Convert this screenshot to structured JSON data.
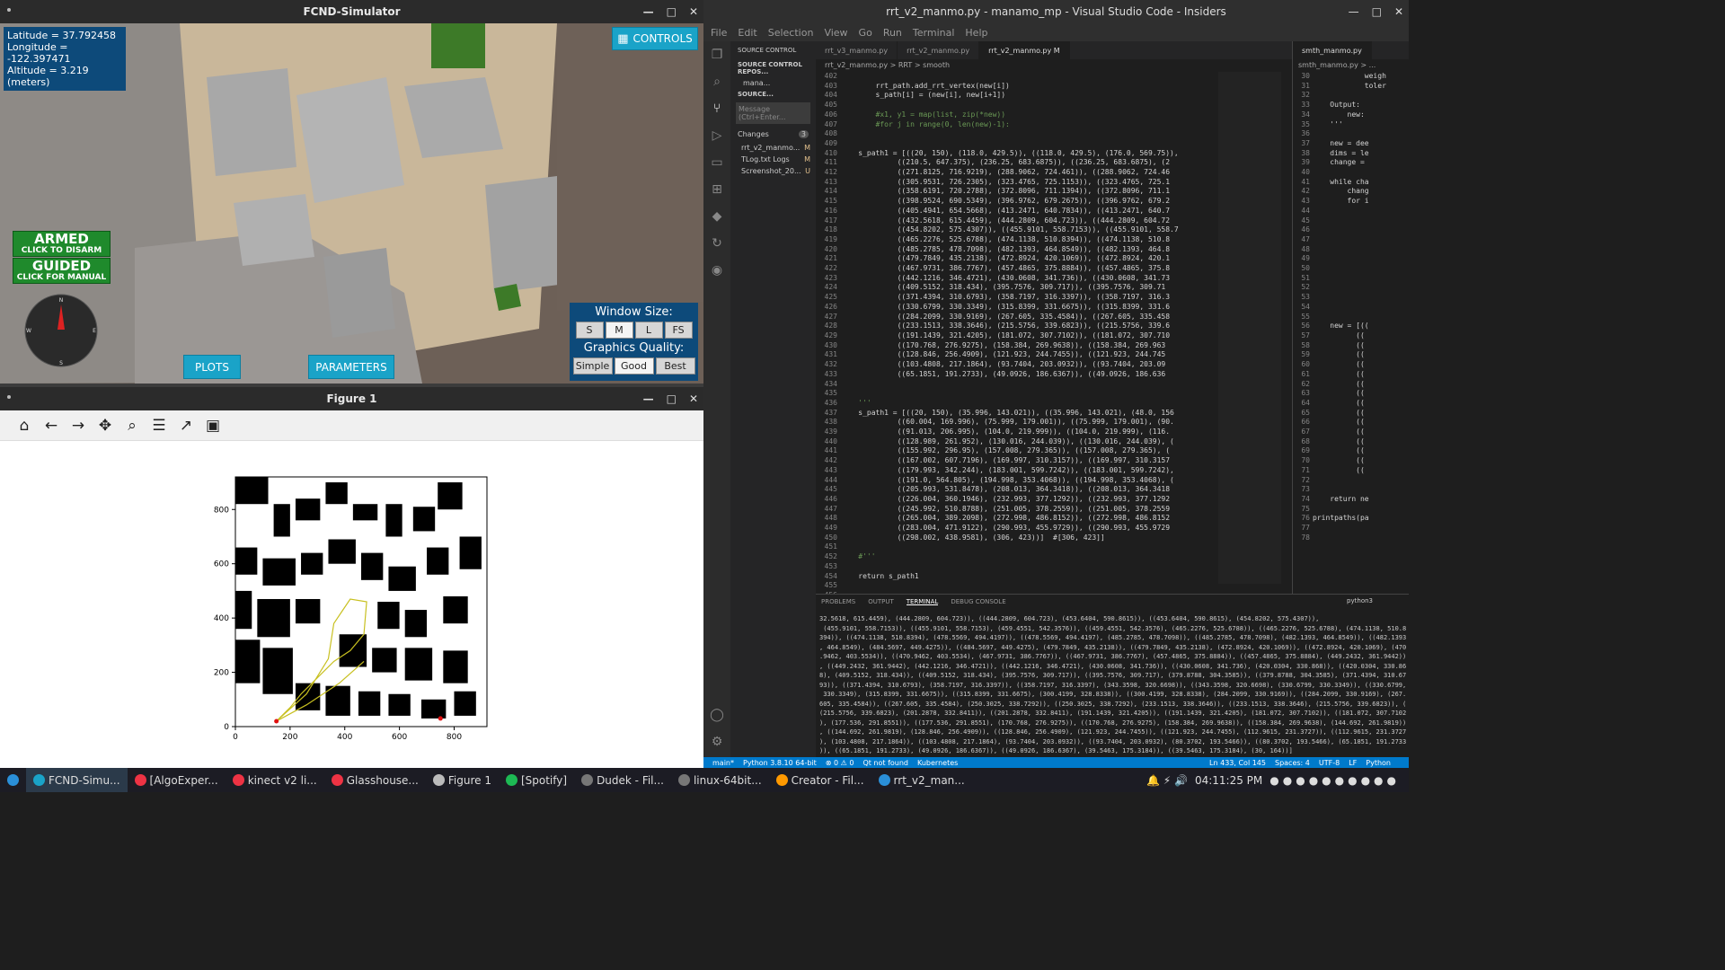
{
  "simulator": {
    "title": "FCND-Simulator",
    "latitude": "Latitude = 37.792458",
    "longitude": "Longitude = -122.397471",
    "altitude": "Altitude = 3.219 (meters)",
    "controls_label": "CONTROLS",
    "armed_label": "ARMED",
    "armed_sub": "CLICK TO DISARM",
    "guided_label": "GUIDED",
    "guided_sub": "CLICK FOR MANUAL",
    "plots_label": "PLOTS",
    "parameters_label": "PARAMETERS",
    "window_size_label": "Window Size:",
    "size_options": [
      "S",
      "M",
      "L",
      "FS"
    ],
    "graphics_label": "Graphics Quality:",
    "quality_options": [
      "Simple",
      "Good",
      "Best"
    ],
    "compass": {
      "n": "N",
      "e": "E",
      "s": "S",
      "w": "W"
    }
  },
  "figure": {
    "title": "Figure 1",
    "chart_data": {
      "type": "line",
      "xticks": [
        "0",
        "200",
        "400",
        "600",
        "800"
      ],
      "yticks": [
        "0",
        "200",
        "400",
        "600",
        "800"
      ],
      "xlim": [
        0,
        920
      ],
      "ylim": [
        0,
        920
      ],
      "path_color": "#c8c020",
      "points_color": "#e01010",
      "start": [
        150,
        20
      ],
      "goal": [
        750,
        30
      ],
      "series": [
        {
          "x": [
            150,
            260,
            340,
            360,
            420,
            480,
            470,
            420,
            360,
            300,
            240,
            200,
            160,
            150
          ],
          "y": [
            20,
            120,
            250,
            380,
            470,
            460,
            340,
            280,
            240,
            180,
            120,
            70,
            30,
            20
          ]
        },
        {
          "x": [
            150,
            260,
            380,
            470
          ],
          "y": [
            20,
            80,
            160,
            240
          ]
        }
      ]
    }
  },
  "vscode": {
    "title": "rrt_v2_manmo.py - manamo_mp - Visual Studio Code - Insiders",
    "menu": [
      "File",
      "Edit",
      "Selection",
      "View",
      "Go",
      "Run",
      "Terminal",
      "Help"
    ],
    "side_title": "SOURCE CONTROL",
    "side_repo": "SOURCE CONTROL REPOS...",
    "side_repo_item": "mana...",
    "side_source": "SOURCE...",
    "message_placeholder": "Message (Ctrl+Enter...",
    "changes_label": "Changes",
    "changes_count": "3",
    "changed_files": [
      {
        "name": "rrt_v2_manmo...",
        "status": "M"
      },
      {
        "name": "TLog.txt Logs",
        "status": "M"
      },
      {
        "name": "Screenshot_20...",
        "status": "U"
      }
    ],
    "tabs": [
      "rrt_v3_manmo.py",
      "rrt_v2_manmo.py",
      "rrt_v2_manmo.py M"
    ],
    "right_tab": "smth_manmo.py",
    "breadcrumb": "rrt_v2_manmo.py > RRT > smooth",
    "right_breadcrumb": "smth_manmo.py > ...",
    "code_start_line": 402,
    "code": [
      "",
      "        rrt_path.add_rrt_vertex(new[i])",
      "        s_path[i] = (new[i], new[i+1])",
      "",
      "        #x1, y1 = map(list, zip(*new))",
      "        #for j in range(0, len(new)-1):",
      "",
      "",
      "    s_path1 = [((20, 150), (118.0, 429.5)), ((118.0, 429.5), (176.0, 569.75)),",
      "             ((210.5, 647.375), (236.25, 683.6875)), ((236.25, 683.6875), (2",
      "             ((271.8125, 716.9219), (288.9062, 724.461)), ((288.9062, 724.46",
      "             ((305.9531, 726.2305), (323.4765, 725.1153)), ((323.4765, 725.1",
      "             ((358.6191, 720.2788), (372.8096, 711.1394)), ((372.8096, 711.1",
      "             ((398.9524, 690.5349), (396.9762, 679.2675)), ((396.9762, 679.2",
      "             ((405.4941, 654.5668), (413.2471, 640.7834)), ((413.2471, 640.7",
      "             ((432.5618, 615.4459), (444.2809, 604.723)), ((444.2809, 604.72",
      "             ((454.8202, 575.4307)), ((455.9101, 558.7153)), ((455.9101, 558.7",
      "             ((465.2276, 525.6788), (474.1138, 510.8394)), ((474.1138, 510.8",
      "             ((485.2785, 478.7098), (482.1393, 464.8549)), ((482.1393, 464.8",
      "             ((479.7849, 435.2138), (472.8924, 420.1069)), ((472.8924, 420.1",
      "             ((467.9731, 386.7767), (457.4865, 375.8884)), ((457.4865, 375.8",
      "             ((442.1216, 346.4721), (430.0608, 341.736)), ((430.0608, 341.73",
      "             ((409.5152, 318.434), (395.7576, 309.717)), ((395.7576, 309.71",
      "             ((371.4394, 310.6793), (358.7197, 316.3397)), ((358.7197, 316.3",
      "             ((330.6799, 330.3349), (315.8399, 331.6675)), ((315.8399, 331.6",
      "             ((284.2099, 330.9169), (267.605, 335.4584)), ((267.605, 335.458",
      "             ((233.1513, 338.3646), (215.5756, 339.6823)), ((215.5756, 339.6",
      "             ((191.1439, 321.4205), (181.072, 307.7102)), ((181.072, 307.710",
      "             ((170.768, 276.9275), (158.384, 269.9638)), ((158.384, 269.963",
      "             ((128.846, 256.4909), (121.923, 244.7455)), ((121.923, 244.745",
      "             ((103.4808, 217.1864), (93.7404, 203.0932)), ((93.7404, 203.09",
      "             ((65.1851, 191.2733), (49.0926, 186.6367)), ((49.0926, 186.636",
      "",
      "",
      "    '''",
      "    s_path1 = [((20, 150), (35.996, 143.021)), ((35.996, 143.021), (48.0, 156",
      "             ((60.004, 169.996), (75.999, 179.001)), ((75.999, 179.001), (90.",
      "             ((91.013, 206.995), (104.0, 219.999)), ((104.0, 219.999), (116.",
      "             ((128.989, 261.952), (130.016, 244.039)), ((130.016, 244.039), (",
      "             ((155.992, 296.95), (157.008, 279.365)), ((157.008, 279.365), (",
      "             ((167.002, 607.7196), (169.997, 310.3157)), ((169.997, 310.3157",
      "             ((179.993, 342.244), (183.001, 599.7242)), ((183.001, 599.7242),",
      "             ((191.0, 564.805), (194.998, 353.4068)), ((194.998, 353.4068), (",
      "             ((205.993, 531.8478), (208.013, 364.3418)), ((208.013, 364.3418",
      "             ((226.004, 360.1946), (232.993, 377.1292)), ((232.993, 377.1292",
      "             ((245.992, 510.8788), (251.005, 378.2559)), ((251.005, 378.2559",
      "             ((265.004, 389.2098), (272.998, 486.8152)), ((272.998, 486.8152",
      "             ((283.004, 471.9122), (290.993, 455.9729)), ((290.993, 455.9729",
      "             ((298.002, 438.9581), (306, 423))]  #[306, 423]]",
      "",
      "    #'''",
      "",
      "    return s_path1",
      "",
      ""
    ],
    "right_start_line": 30,
    "right_code": [
      "            weigh",
      "            toler",
      "",
      "    Output:",
      "        new:",
      "    '''",
      "",
      "    new = dee",
      "    dims = le",
      "    change =",
      "",
      "    while cha",
      "        chang",
      "        for i",
      "",
      "",
      "",
      "",
      "",
      "",
      "",
      "",
      "",
      "",
      "",
      "",
      "    new = [((",
      "          ((",
      "          ((",
      "          ((",
      "          ((",
      "          ((",
      "          ((",
      "          ((",
      "          ((",
      "          ((",
      "          ((",
      "          ((",
      "          ((",
      "          ((",
      "          ((",
      "          ((",
      "",
      "",
      "    return ne",
      "",
      "printpaths(pa",
      "",
      ""
    ],
    "panel_tabs": [
      "PROBLEMS",
      "OUTPUT",
      "TERMINAL",
      "DEBUG CONSOLE"
    ],
    "terminal_shell": "python3",
    "terminal": [
      "32.5618, 615.4459), (444.2809, 604.723)), ((444.2809, 604.723), (453.6404, 590.8615)), ((453.6404, 590.8615), (454.8202, 575.4307)),",
      " (455.9101, 558.7153)), ((455.9101, 558.7153), (459.4551, 542.3576)), ((459.4551, 542.3576), (465.2276, 525.6788)), ((465.2276, 525.6788), (474.1138, 510.8",
      "394)), ((474.1138, 510.8394), (478.5569, 494.4197)), ((478.5569, 494.4197), (485.2785, 478.7098)), ((485.2785, 478.7098), (482.1393, 464.8549)), ((482.1393",
      ", 464.8549), (484.5697, 449.4275)), ((484.5697, 449.4275), (479.7849, 435.2138)), ((479.7849, 435.2138), (472.8924, 420.1069)), ((472.8924, 420.1069), (470",
      ".9462, 403.5534)), ((470.9462, 403.5534), (467.9731, 386.7767)), ((467.9731, 386.7767), (457.4865, 375.8884)), ((457.4865, 375.8884), (449.2432, 361.9442))",
      ", ((449.2432, 361.9442), (442.1216, 346.4721)), ((442.1216, 346.4721), (430.0608, 341.736)), ((430.0608, 341.736), (420.0304, 330.868)), ((420.0304, 330.86",
      "8), (409.5152, 318.434)), ((409.5152, 318.434), (395.7576, 309.717)), ((395.7576, 309.717), (379.8788, 304.3585)), ((379.8788, 304.3585), (371.4394, 310.67",
      "93)), ((371.4394, 310.6793), (358.7197, 316.3397)), ((358.7197, 316.3397), (343.3598, 320.6698)), ((343.3598, 320.6698), (330.6799, 330.3349)), ((330.6799,",
      " 330.3349), (315.8399, 331.6675)), ((315.8399, 331.6675), (300.4199, 328.8338)), ((300.4199, 328.8338), (284.2099, 330.9169)), ((284.2099, 330.9169), (267.",
      "605, 335.4584)), ((267.605, 335.4584), (250.3025, 338.7292)), ((250.3025, 338.7292), (233.1513, 338.3646)), ((233.1513, 338.3646), (215.5756, 339.6823)), (",
      "(215.5756, 339.6823), (201.2878, 332.8411)), ((201.2878, 332.8411), (191.1439, 321.4205)), ((191.1439, 321.4205), (181.072, 307.7102)), ((181.072, 307.7102",
      "), (177.536, 291.8551)), ((177.536, 291.8551), (170.768, 276.9275)), ((170.768, 276.9275), (158.384, 269.9638)), ((158.384, 269.9638), (144.692, 261.9819))",
      ", ((144.692, 261.9819), (128.846, 256.4909)), ((128.846, 256.4909), (121.923, 244.7455)), ((121.923, 244.7455), (112.9615, 231.3727)), ((112.9615, 231.3727",
      "), (103.4808, 217.1864)), ((103.4808, 217.1864), (93.7404, 203.0932)), ((93.7404, 203.0932), (80.3702, 193.5466)), ((80.3702, 193.5466), (65.1851, 191.2733",
      ")), ((65.1851, 191.2733), (49.0926, 186.6367)), ((49.0926, 186.6367), (39.5463, 175.3184)), ((39.5463, 175.3184), (30, 164))]"
    ],
    "status": {
      "branch": "main*",
      "python": "Python 3.8.10 64-bit",
      "problems": "⊗ 0 ⚠ 0",
      "qt": "Qt not found",
      "k8s": "Kubernetes",
      "position": "Ln 433, Col 145",
      "spaces": "Spaces: 4",
      "encoding": "UTF-8",
      "eol": "LF",
      "lang": "Python"
    }
  },
  "taskbar": {
    "items": [
      "FCND-Simu...",
      "[AlgoExper...",
      "kinect v2 li...",
      "Glasshouse...",
      "Figure 1",
      "[Spotify]",
      "Dudek - Fil...",
      "linux-64bit...",
      "Creator - Fil...",
      "rrt_v2_man..."
    ],
    "clock": "04:11:25 PM"
  }
}
